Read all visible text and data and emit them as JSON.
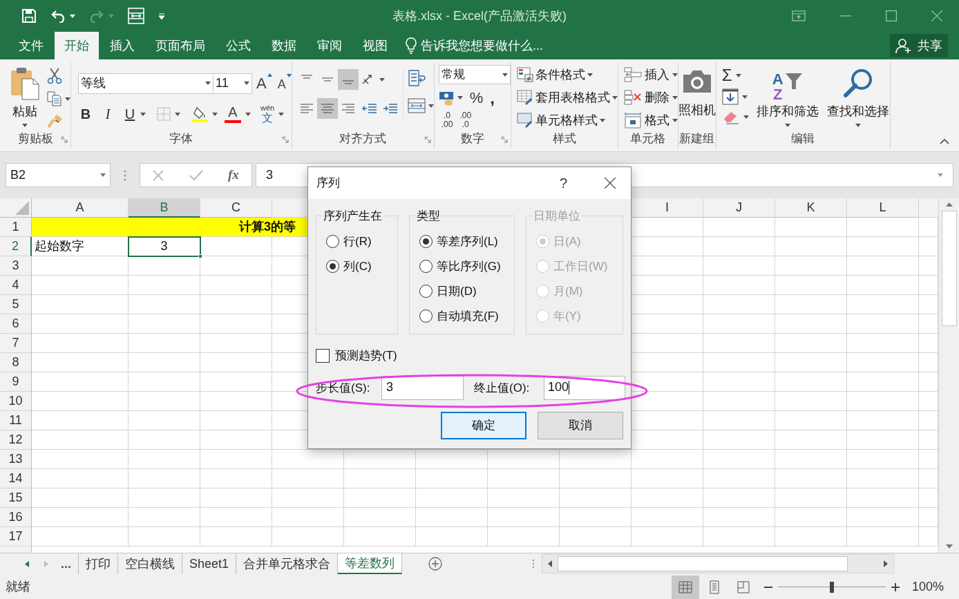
{
  "title_bar": {
    "title": "表格.xlsx - Excel(产品激活失败)",
    "redo_disabled": true
  },
  "ribbon_tabs": [
    {
      "label": "文件",
      "selected": false
    },
    {
      "label": "开始",
      "selected": true
    },
    {
      "label": "插入",
      "selected": false
    },
    {
      "label": "页面布局",
      "selected": false
    },
    {
      "label": "公式",
      "selected": false
    },
    {
      "label": "数据",
      "selected": false
    },
    {
      "label": "审阅",
      "selected": false
    },
    {
      "label": "视图",
      "selected": false
    }
  ],
  "tell_me": {
    "placeholder": "告诉我您想要做什么..."
  },
  "share_button": {
    "label": "共享"
  },
  "ribbon": {
    "clipboard": {
      "paste": "粘贴",
      "group": "剪贴板"
    },
    "font": {
      "font_name": "等线",
      "font_size": "11",
      "grow": "A",
      "shrink": "A",
      "bold": "B",
      "italic": "I",
      "underline": "U",
      "font_color": "A",
      "phonetic_top": "wén",
      "phonetic_bottom": "文",
      "group": "字体"
    },
    "alignment": {
      "vertical_align_buttons": [
        {
          "selected": false
        },
        {
          "selected": false
        },
        {
          "selected": true
        }
      ],
      "horizontal_align_buttons": [
        {
          "selected": false
        },
        {
          "selected": true
        },
        {
          "selected": false
        }
      ],
      "group": "对齐方式"
    },
    "number": {
      "format": "常规",
      "percent": "%",
      "comma": ",",
      "increase_decimal": [
        ".0",
        ".00"
      ],
      "decrease_decimal": [
        ".00",
        ".0"
      ],
      "group": "数字"
    },
    "styles": {
      "items": [
        "条件格式",
        "套用表格格式",
        "单元格样式"
      ],
      "group": "样式"
    },
    "cells": {
      "items": [
        "插入",
        "删除",
        "格式"
      ],
      "group": "单元格"
    },
    "new_group": {
      "camera": "照相机",
      "group": "新建组"
    },
    "editing": {
      "sum": "Σ",
      "sort_letters": [
        "A",
        "Z"
      ],
      "sort_filter": "排序和筛选",
      "find_select": "查找和选择",
      "group": "编辑"
    }
  },
  "formula_bar": {
    "name_box": "B2",
    "fx": "fx",
    "value": "3"
  },
  "sheet": {
    "columns_left": [
      {
        "label": "A",
        "selected": false
      },
      {
        "label": "B",
        "selected": true
      },
      {
        "label": "C",
        "selected": false
      }
    ],
    "columns_right": [
      {
        "label": "I",
        "selected": false
      },
      {
        "label": "J",
        "selected": false
      },
      {
        "label": "K",
        "selected": false
      },
      {
        "label": "L",
        "selected": false
      }
    ],
    "rows": [
      {
        "number": "1",
        "selected": false,
        "cells": [
          {
            "kind": "merged",
            "text": "计算3的等",
            "selected": false
          }
        ]
      },
      {
        "number": "2",
        "selected": true,
        "cells": [
          {
            "kind": "text",
            "text": "起始数字",
            "selected": false
          },
          {
            "kind": "number",
            "text": "3",
            "selected": true
          }
        ]
      },
      {
        "number": "3",
        "selected": false
      },
      {
        "number": "4",
        "selected": false
      },
      {
        "number": "5",
        "selected": false
      },
      {
        "number": "6",
        "selected": false
      },
      {
        "number": "7",
        "selected": false
      },
      {
        "number": "8",
        "selected": false
      },
      {
        "number": "9",
        "selected": false
      },
      {
        "number": "10",
        "selected": false
      },
      {
        "number": "11",
        "selected": false
      },
      {
        "number": "12",
        "selected": false
      },
      {
        "number": "13",
        "selected": false
      },
      {
        "number": "14",
        "selected": false
      },
      {
        "number": "15",
        "selected": false
      },
      {
        "number": "16",
        "selected": false
      },
      {
        "number": "17",
        "selected": false
      }
    ]
  },
  "sheet_tabs": {
    "more": "...",
    "tabs": [
      {
        "label": "打印",
        "selected": false
      },
      {
        "label": "空白横线",
        "selected": false
      },
      {
        "label": "Sheet1",
        "selected": false
      },
      {
        "label": "合并单元格求合",
        "selected": false
      },
      {
        "label": "等差数列",
        "selected": true
      }
    ]
  },
  "status_bar": {
    "status": "就绪",
    "views": [
      {
        "selected": true
      },
      {
        "selected": false
      },
      {
        "selected": false
      }
    ],
    "zoom": {
      "level": 0.5,
      "reading": "100%"
    }
  },
  "dialog": {
    "title": "序列",
    "help": "?",
    "groups": [
      {
        "title": "序列产生在",
        "disabled": false,
        "options": [
          {
            "label": "行(R)",
            "selected": false
          },
          {
            "label": "列(C)",
            "selected": true
          }
        ]
      },
      {
        "title": "类型",
        "disabled": false,
        "options": [
          {
            "label": "等差序列(L)",
            "selected": true
          },
          {
            "label": "等比序列(G)",
            "selected": false
          },
          {
            "label": "日期(D)",
            "selected": false
          },
          {
            "label": "自动填充(F)",
            "selected": false
          }
        ]
      },
      {
        "title": "日期单位",
        "disabled": true,
        "options": [
          {
            "label": "日(A)",
            "selected": true
          },
          {
            "label": "工作日(W)",
            "selected": false
          },
          {
            "label": "月(M)",
            "selected": false
          },
          {
            "label": "年(Y)",
            "selected": false
          }
        ]
      }
    ],
    "trend": {
      "label": "预测趋势(T)",
      "checked": false
    },
    "step": {
      "label": "步长值(S):",
      "value": "3"
    },
    "stop": {
      "label": "终止值(O):",
      "value": "100"
    },
    "buttons": [
      {
        "label": "确定",
        "kind": "default"
      },
      {
        "label": "取消",
        "kind": "normal"
      }
    ]
  }
}
